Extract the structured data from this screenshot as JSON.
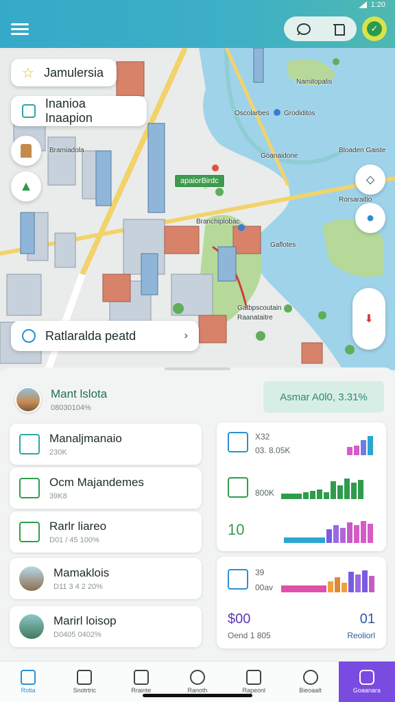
{
  "status": {
    "time": "1:20"
  },
  "map": {
    "chips": {
      "favorite": "Jamulersia",
      "info": "Inanioa Inaapion",
      "route": "Ratlaralda peatd"
    },
    "badge": "apaiorBirdc",
    "labels": [
      "Namitopalis",
      "Oscolarbes",
      "Grodiditos",
      "Goanaidone",
      "Bramiadola",
      "Bloaden Gaiste",
      "Rorsaraitio",
      "Branchiplobac",
      "Gaflotes",
      "Gatbpscoutain",
      "Raanataitre"
    ]
  },
  "sheet": {
    "title": "Mant lslota",
    "subtitle": "08030104%",
    "pill": "Asmar A0l0, 3.31%",
    "items": [
      {
        "title": "Manaljmanaio",
        "sub": "230K"
      },
      {
        "title": "Ocm Majandemes",
        "sub": "39K8"
      },
      {
        "title": "Rarlr liareo",
        "sub": "D01 / 45 100%"
      },
      {
        "title": "Mamaklois",
        "sub": "D11 3 4 2 20%"
      },
      {
        "title": "Marirl loisop",
        "sub": "D0405 0402%"
      }
    ],
    "stats": {
      "a_top": "X32",
      "a_val": "03. 8.05K",
      "b_val": "800K",
      "c_val": "10",
      "d_top": "39",
      "d_val": "00av",
      "e_left": "$00",
      "e_right": "01",
      "e_left_sub": "Oend 1 805",
      "e_right_sub": "Reoliorl"
    }
  },
  "nav": [
    {
      "label": "Rotia",
      "icon": "home-icon"
    },
    {
      "label": "Snotrtric",
      "icon": "calendar-icon"
    },
    {
      "label": "Rrainte",
      "icon": "box-icon"
    },
    {
      "label": "Ranoth",
      "icon": "location-icon"
    },
    {
      "label": "Rapeonl",
      "icon": "folder-icon"
    },
    {
      "label": "Bieoaalt",
      "icon": "user-icon"
    },
    {
      "label": "Goaanara",
      "icon": "app-icon"
    }
  ],
  "colors": {
    "accent": "#7a4be0",
    "teal": "#35a9c8",
    "green": "#2f9c4c"
  }
}
